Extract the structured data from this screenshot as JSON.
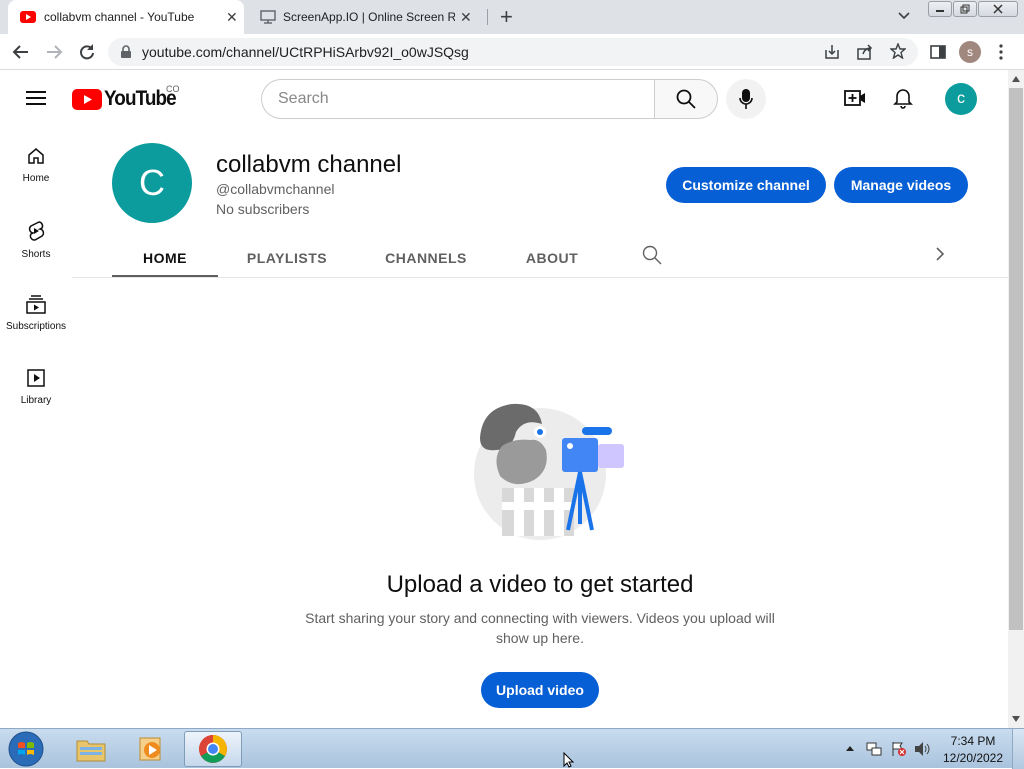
{
  "browser": {
    "tabs": [
      {
        "title": "collabvm channel - YouTube",
        "close": "✕"
      },
      {
        "title": "ScreenApp.IO | Online Screen Re",
        "close": "✕"
      }
    ],
    "new_tab": "+",
    "url": "youtube.com/channel/UCtRPHiSArbv92I_o0wJSQsg",
    "profile_initial": "s"
  },
  "masthead": {
    "logo_text": "YouTube",
    "country_code": "CO",
    "search_placeholder": "Search",
    "account_initial": "c"
  },
  "guide": [
    {
      "label": "Home",
      "icon": "home-icon"
    },
    {
      "label": "Shorts",
      "icon": "shorts-icon"
    },
    {
      "label": "Subscriptions",
      "icon": "subscriptions-icon"
    },
    {
      "label": "Library",
      "icon": "library-icon"
    }
  ],
  "channel": {
    "avatar_initial": "C",
    "name": "collabvm channel",
    "handle": "@collabvmchannel",
    "subscribers": "No subscribers",
    "customize_label": "Customize channel",
    "manage_label": "Manage videos",
    "tabs": [
      "HOME",
      "PLAYLISTS",
      "CHANNELS",
      "ABOUT"
    ],
    "active_tab": "HOME"
  },
  "empty_state": {
    "title": "Upload a video to get started",
    "description_line1": "Start sharing your story and connecting with viewers. Videos you upload will",
    "description_line2": "show up here.",
    "upload_label": "Upload video"
  },
  "taskbar": {
    "time": "7:34 PM",
    "date": "12/20/2022"
  },
  "colors": {
    "brand_red": "#ff0000",
    "button_blue": "#065fd4",
    "avatar_teal": "#0c9c9d",
    "tab_strip": "#dee1e6"
  }
}
